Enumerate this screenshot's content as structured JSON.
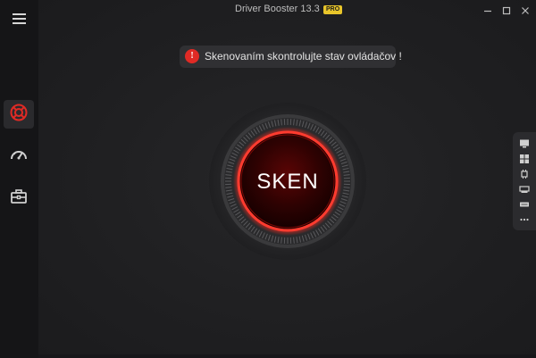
{
  "app": {
    "title": "Driver Booster 13.3",
    "badge": "PRO",
    "accent": "#e02a25"
  },
  "sidebar": {
    "items": [
      {
        "name": "menu",
        "icon": "hamburger-icon"
      },
      {
        "name": "scan",
        "icon": "lifebuoy-icon",
        "active": true
      },
      {
        "name": "boost",
        "icon": "speedometer-icon"
      },
      {
        "name": "toolbox",
        "icon": "toolbox-icon"
      }
    ]
  },
  "window_controls": {
    "minimize": "—",
    "maximize": "☐",
    "close": "✕"
  },
  "notice": {
    "icon": "!",
    "text": "Skenovaním skontrolujte stav ovládačov !"
  },
  "scan_button": {
    "label": "SKEN"
  },
  "right_tray": {
    "items": [
      {
        "icon": "monitor-icon"
      },
      {
        "icon": "windows-icon"
      },
      {
        "icon": "chip-icon"
      },
      {
        "icon": "network-card-icon"
      },
      {
        "icon": "keyboard-icon"
      },
      {
        "icon": "more-icon"
      }
    ]
  }
}
